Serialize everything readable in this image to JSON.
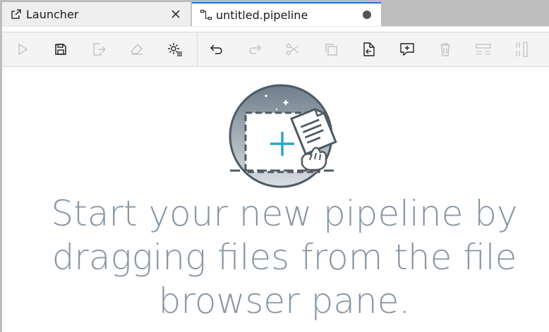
{
  "tabs": [
    {
      "label": "Launcher",
      "icon": "launch-icon",
      "closable": true,
      "active": false
    },
    {
      "label": "untitled.pipeline",
      "icon": "pipeline-icon",
      "dirty": true,
      "active": true
    }
  ],
  "toolbar": {
    "buttons": [
      {
        "name": "run-pipeline",
        "icon": "play-icon",
        "enabled": false
      },
      {
        "name": "save-pipeline",
        "icon": "save-icon",
        "enabled": true
      },
      {
        "name": "export-pipeline",
        "icon": "export-icon",
        "enabled": false
      },
      {
        "name": "clear-pipeline",
        "icon": "eraser-icon",
        "enabled": false
      },
      {
        "name": "runtimes",
        "icon": "runtime-settings-icon",
        "enabled": true
      },
      {
        "name": "undo",
        "icon": "undo-icon",
        "enabled": true
      },
      {
        "name": "redo",
        "icon": "redo-icon",
        "enabled": false
      },
      {
        "name": "cut",
        "icon": "cut-icon",
        "enabled": false
      },
      {
        "name": "copy",
        "icon": "copy-icon",
        "enabled": false
      },
      {
        "name": "paste",
        "icon": "paste-icon",
        "enabled": true
      },
      {
        "name": "add-comment",
        "icon": "comment-add-icon",
        "enabled": true
      },
      {
        "name": "delete",
        "icon": "trash-icon",
        "enabled": false
      },
      {
        "name": "arrange-horizontal",
        "icon": "arrange-horizontal-icon",
        "enabled": false
      },
      {
        "name": "arrange-vertical",
        "icon": "arrange-vertical-icon",
        "enabled": false
      }
    ]
  },
  "canvas": {
    "empty_message": "Start your new pipeline by dragging files from the file browser pane."
  },
  "colors": {
    "accent": "#1f78d1",
    "illustration_plus": "#2aa6c9",
    "empty_text": "#8a97a3"
  }
}
